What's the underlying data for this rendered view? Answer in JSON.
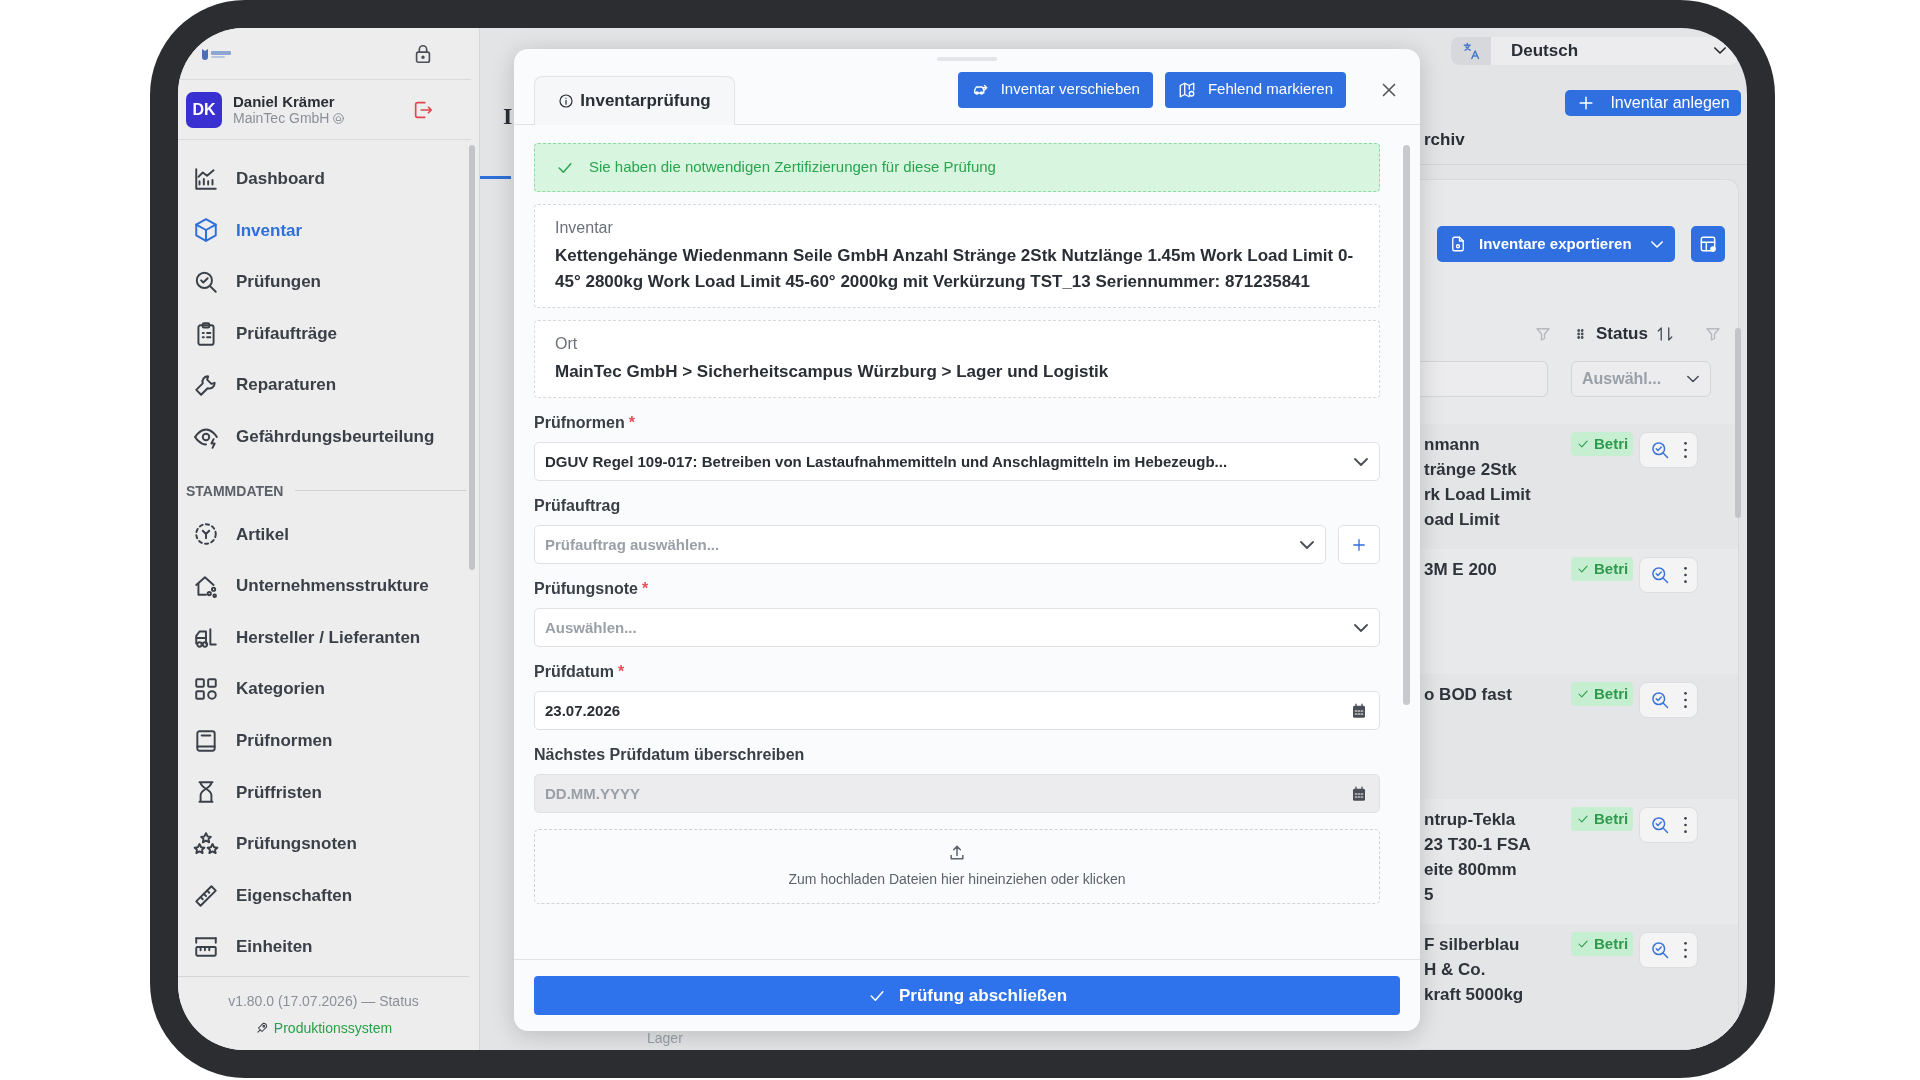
{
  "sidebar": {
    "user": {
      "initials": "DK",
      "name": "Daniel Krämer",
      "company": "MainTec GmbH"
    },
    "items": [
      {
        "label": "Dashboard",
        "selected": false
      },
      {
        "label": "Inventar",
        "selected": true
      },
      {
        "label": "Prüfungen",
        "selected": false
      },
      {
        "label": "Prüfaufträge",
        "selected": false
      },
      {
        "label": "Reparaturen",
        "selected": false
      },
      {
        "label": "Gefährdungsbeurteilung",
        "selected": false
      }
    ],
    "section_title": "STAMMDATEN",
    "master_items": [
      {
        "label": "Artikel",
        "selected": false
      },
      {
        "label": "Unternehmensstrukture",
        "selected": false
      },
      {
        "label": "Hersteller / Lieferanten",
        "selected": false
      },
      {
        "label": "Kategorien",
        "selected": false
      },
      {
        "label": "Prüfnormen",
        "selected": false
      },
      {
        "label": "Prüffristen",
        "selected": false
      },
      {
        "label": "Prüfungsnoten",
        "selected": false
      },
      {
        "label": "Eigenschaften",
        "selected": false
      },
      {
        "label": "Einheiten",
        "selected": false
      }
    ],
    "version": "v1.80.0 (17.07.2026) —",
    "status_link": "Status",
    "environment": "Produktionssystem"
  },
  "topbar": {
    "language": "Deutsch"
  },
  "page": {
    "title_fragment": "I",
    "create_button": "Inventar anlegen",
    "tab_fragment": "rchiv",
    "export_button": "Inventare exportieren",
    "footer_fragment": "Lager"
  },
  "table": {
    "status_header": "Status",
    "status_filter_placeholder": "Auswähl...",
    "rows": [
      {
        "text_lines": [
          "nmann",
          "tränge 2Stk",
          "rk Load Limit",
          "oad Limit"
        ],
        "status": "Betri"
      },
      {
        "text_lines": [
          "3M E 200"
        ],
        "status": "Betri"
      },
      {
        "text_lines": [
          "o BOD fast"
        ],
        "status": "Betri"
      },
      {
        "text_lines": [
          "ntrup-Tekla",
          "23 T30-1 FSA",
          "eite 800mm",
          "5"
        ],
        "status": "Betri"
      },
      {
        "text_lines": [
          "F silberblau",
          "H & Co.",
          "kraft 5000kg"
        ],
        "status": "Betri"
      }
    ]
  },
  "modal": {
    "tabs": [
      {
        "label": "Inventarprüfung",
        "selected": true
      }
    ],
    "actions": [
      "Inventar verschieben",
      "Fehlend markieren"
    ],
    "alert": "Sie haben die notwendigen Zertifizierungen für diese Prüfung",
    "inventory": {
      "label": "Inventar",
      "value": "Kettengehänge Wiedenmann Seile GmbH Anzahl Stränge 2Stk Nutzlänge 1.45m Work Load Limit 0-45° 2800kg Work Load Limit 45-60° 2000kg mit Verkürzung TST_13 Seriennummer: 871235841"
    },
    "location": {
      "label": "Ort",
      "value": "MainTec GmbH > Sicherheitscampus Würzburg > Lager und Logistik"
    },
    "fields": [
      {
        "kind": "select",
        "label": "Prüfnormen",
        "required_mark": "*",
        "value": "DGUV Regel 109-017: Betreiben von Lastaufnahmemitteln und Anschlagmitteln im Hebezeugb...",
        "disabled": false
      },
      {
        "kind": "select",
        "label": "Prüfauftrag",
        "placeholder": "Prüfauftrag auswählen...",
        "add_button": true,
        "disabled": false
      },
      {
        "kind": "select",
        "label": "Prüfungsnote",
        "required_mark": "*",
        "placeholder": "Auswählen...",
        "disabled": false
      },
      {
        "kind": "date",
        "label": "Prüfdatum",
        "required_mark": "*",
        "value": "23.07.2026",
        "disabled": false
      },
      {
        "kind": "date",
        "label": "Nächstes Prüfdatum überschreiben",
        "placeholder": "DD.MM.YYYY",
        "disabled": true
      }
    ],
    "upload": "Zum hochladen Dateien hier hineinziehen oder klicken",
    "submit": "Prüfung abschließen"
  }
}
